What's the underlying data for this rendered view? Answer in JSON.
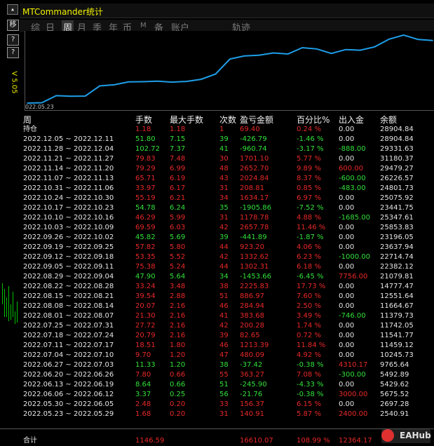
{
  "app": {
    "title": "MTCommander统计",
    "version": "V 5.05",
    "watermark": "EAHub"
  },
  "side_buttons": [
    "移",
    "?",
    "?"
  ],
  "tabs": [
    {
      "label": "综",
      "active": false
    },
    {
      "label": "日",
      "active": false
    },
    {
      "label": "周",
      "active": true
    },
    {
      "label": "月",
      "active": false
    },
    {
      "label": "季",
      "active": false
    },
    {
      "label": "年",
      "active": false
    },
    {
      "label": "币",
      "active": false
    },
    {
      "label": "M",
      "active": false
    },
    {
      "label": "备",
      "active": false
    },
    {
      "label": "账户",
      "active": false
    },
    {
      "label": "轨迹",
      "active": false
    }
  ],
  "colors": {
    "green": "#33e03a",
    "red": "#e82828",
    "white": "#e6e6e6",
    "line": "#1e9ee8",
    "title": "#f2f200"
  },
  "chart_data": {
    "type": "line",
    "x_label_start": "022.05.23",
    "series": [
      {
        "name": "",
        "values": [
          2540.91,
          2697.28,
          5675.52,
          5429.62,
          5492.89,
          9765.64,
          10245.73,
          11459.12,
          11541.77,
          11742.05,
          11379.73,
          11664.67,
          12551.64,
          14777.47,
          21079.81,
          22382.12,
          22714.74,
          23637.94,
          23196.05,
          25853.83,
          25347.61,
          23441.75,
          25075.92,
          24801.73,
          26226.57,
          29479.27,
          31180.37,
          29331.63,
          28904.84
        ]
      }
    ]
  },
  "table": {
    "headers": [
      "周",
      "手数",
      "最大手数",
      "次数",
      "盈亏金额",
      "百分比%",
      "出入金",
      "余额"
    ],
    "rows": [
      {
        "period": "持仓",
        "lots": "1.18",
        "max": "1.18",
        "n": "1",
        "pl": "69.40",
        "pct": "0.24 %",
        "io": "0.00",
        "bal": "28904.84",
        "c": "red",
        "io_c": "white"
      },
      {
        "period": "2022.12.05 ~ 2022.12.11",
        "lots": "51.80",
        "max": "7.15",
        "n": "39",
        "pl": "-426.79",
        "pct": "-1.46 %",
        "io": "0.00",
        "bal": "28904.84",
        "c": "green",
        "io_c": "white"
      },
      {
        "period": "2022.11.28 ~ 2022.12.04",
        "lots": "102.72",
        "max": "7.37",
        "n": "41",
        "pl": "-960.74",
        "pct": "-3.17 %",
        "io": "-888.00",
        "bal": "29331.63",
        "c": "green",
        "io_c": "green"
      },
      {
        "period": "2022.11.21 ~ 2022.11.27",
        "lots": "79.83",
        "max": "7.48",
        "n": "30",
        "pl": "1701.10",
        "pct": "5.77 %",
        "io": "0.00",
        "bal": "31180.37",
        "c": "red",
        "io_c": "white"
      },
      {
        "period": "2022.11.14 ~ 2022.11.20",
        "lots": "79.29",
        "max": "6.99",
        "n": "48",
        "pl": "2652.70",
        "pct": "9.89 %",
        "io": "600.00",
        "bal": "29479.27",
        "c": "red",
        "io_c": "red"
      },
      {
        "period": "2022.11.07 ~ 2022.11.13",
        "lots": "65.71",
        "max": "6.19",
        "n": "43",
        "pl": "2024.84",
        "pct": "8.37 %",
        "io": "-600.00",
        "bal": "26226.57",
        "c": "red",
        "io_c": "green"
      },
      {
        "period": "2022.10.31 ~ 2022.11.06",
        "lots": "33.97",
        "max": "6.17",
        "n": "31",
        "pl": "208.81",
        "pct": "0.85 %",
        "io": "-483.00",
        "bal": "24801.73",
        "c": "red",
        "io_c": "green"
      },
      {
        "period": "2022.10.24 ~ 2022.10.30",
        "lots": "55.19",
        "max": "6.21",
        "n": "34",
        "pl": "1634.17",
        "pct": "6.97 %",
        "io": "0.00",
        "bal": "25075.92",
        "c": "red",
        "io_c": "white"
      },
      {
        "period": "2022.10.17 ~ 2022.10.23",
        "lots": "54.78",
        "max": "6.24",
        "n": "35",
        "pl": "-1905.86",
        "pct": "-7.52 %",
        "io": "0.00",
        "bal": "23441.75",
        "c": "green",
        "io_c": "white"
      },
      {
        "period": "2022.10.10 ~ 2022.10.16",
        "lots": "46.29",
        "max": "5.99",
        "n": "31",
        "pl": "1178.78",
        "pct": "4.88 %",
        "io": "-1685.00",
        "bal": "25347.61",
        "c": "red",
        "io_c": "green"
      },
      {
        "period": "2022.10.03 ~ 2022.10.09",
        "lots": "69.59",
        "max": "6.03",
        "n": "42",
        "pl": "2657.78",
        "pct": "11.46 %",
        "io": "0.00",
        "bal": "25853.83",
        "c": "red",
        "io_c": "white"
      },
      {
        "period": "2022.09.26 ~ 2022.10.02",
        "lots": "45.82",
        "max": "5.69",
        "n": "39",
        "pl": "-441.89",
        "pct": "-1.87 %",
        "io": "0.00",
        "bal": "23196.05",
        "c": "green",
        "io_c": "white"
      },
      {
        "period": "2022.09.19 ~ 2022.09.25",
        "lots": "57.82",
        "max": "5.80",
        "n": "44",
        "pl": "923.20",
        "pct": "4.06 %",
        "io": "0.00",
        "bal": "23637.94",
        "c": "red",
        "io_c": "white"
      },
      {
        "period": "2022.09.12 ~ 2022.09.18",
        "lots": "53.35",
        "max": "5.52",
        "n": "42",
        "pl": "1332.62",
        "pct": "6.23 %",
        "io": "-1000.00",
        "bal": "22714.74",
        "c": "red",
        "io_c": "green"
      },
      {
        "period": "2022.09.05 ~ 2022.09.11",
        "lots": "75.38",
        "max": "5.24",
        "n": "44",
        "pl": "1302.31",
        "pct": "6.18 %",
        "io": "0.00",
        "bal": "22382.12",
        "c": "red",
        "io_c": "white"
      },
      {
        "period": "2022.08.29 ~ 2022.09.04",
        "lots": "47.90",
        "max": "5.64",
        "n": "34",
        "pl": "-1453.66",
        "pct": "-6.45 %",
        "io": "7756.00",
        "bal": "21079.81",
        "c": "green",
        "io_c": "red"
      },
      {
        "period": "2022.08.22 ~ 2022.08.28",
        "lots": "33.24",
        "max": "3.48",
        "n": "38",
        "pl": "2225.83",
        "pct": "17.73 %",
        "io": "0.00",
        "bal": "14777.47",
        "c": "red",
        "io_c": "white"
      },
      {
        "period": "2022.08.15 ~ 2022.08.21",
        "lots": "39.54",
        "max": "2.88",
        "n": "51",
        "pl": "886.97",
        "pct": "7.60 %",
        "io": "0.00",
        "bal": "12551.64",
        "c": "red",
        "io_c": "white"
      },
      {
        "period": "2022.08.08 ~ 2022.08.14",
        "lots": "20.07",
        "max": "2.16",
        "n": "46",
        "pl": "284.94",
        "pct": "2.50 %",
        "io": "0.00",
        "bal": "11664.67",
        "c": "red",
        "io_c": "white"
      },
      {
        "period": "2022.08.01 ~ 2022.08.07",
        "lots": "21.30",
        "max": "2.16",
        "n": "41",
        "pl": "383.68",
        "pct": "3.49 %",
        "io": "-746.00",
        "bal": "11379.73",
        "c": "red",
        "io_c": "green"
      },
      {
        "period": "2022.07.25 ~ 2022.07.31",
        "lots": "27.72",
        "max": "2.16",
        "n": "42",
        "pl": "200.28",
        "pct": "1.74 %",
        "io": "0.00",
        "bal": "11742.05",
        "c": "red",
        "io_c": "white"
      },
      {
        "period": "2022.07.18 ~ 2022.07.24",
        "lots": "20.79",
        "max": "2.16",
        "n": "39",
        "pl": "82.65",
        "pct": "0.72 %",
        "io": "0.00",
        "bal": "11541.77",
        "c": "red",
        "io_c": "white"
      },
      {
        "period": "2022.07.11 ~ 2022.07.17",
        "lots": "18.51",
        "max": "1.80",
        "n": "46",
        "pl": "1213.39",
        "pct": "11.84 %",
        "io": "0.00",
        "bal": "11459.12",
        "c": "red",
        "io_c": "white"
      },
      {
        "period": "2022.07.04 ~ 2022.07.10",
        "lots": "9.70",
        "max": "1.20",
        "n": "47",
        "pl": "480.09",
        "pct": "4.92 %",
        "io": "0.00",
        "bal": "10245.73",
        "c": "red",
        "io_c": "white"
      },
      {
        "period": "2022.06.27 ~ 2022.07.03",
        "lots": "11.33",
        "max": "1.20",
        "n": "38",
        "pl": "-37.42",
        "pct": "-0.38 %",
        "io": "4310.17",
        "bal": "9765.64",
        "c": "green",
        "io_c": "red"
      },
      {
        "period": "2022.06.20 ~ 2022.06.26",
        "lots": "7.80",
        "max": "0.66",
        "n": "55",
        "pl": "363.27",
        "pct": "7.08 %",
        "io": "-300.00",
        "bal": "5492.89",
        "c": "red",
        "io_c": "green"
      },
      {
        "period": "2022.06.13 ~ 2022.06.19",
        "lots": "8.64",
        "max": "0.66",
        "n": "51",
        "pl": "-245.90",
        "pct": "-4.33 %",
        "io": "0.00",
        "bal": "5429.62",
        "c": "green",
        "io_c": "white"
      },
      {
        "period": "2022.06.06 ~ 2022.06.12",
        "lots": "3.37",
        "max": "0.25",
        "n": "56",
        "pl": "-21.76",
        "pct": "-0.38 %",
        "io": "3000.00",
        "bal": "5675.52",
        "c": "green",
        "io_c": "red"
      },
      {
        "period": "2022.05.30 ~ 2022.06.05",
        "lots": "2.48",
        "max": "0.20",
        "n": "33",
        "pl": "156.37",
        "pct": "6.15 %",
        "io": "0.00",
        "bal": "2697.28",
        "c": "red",
        "io_c": "white"
      },
      {
        "period": "2022.05.23 ~ 2022.05.29",
        "lots": "1.68",
        "max": "0.20",
        "n": "31",
        "pl": "140.91",
        "pct": "5.87 %",
        "io": "2400.00",
        "bal": "2540.91",
        "c": "red",
        "io_c": "red"
      }
    ],
    "total": {
      "period": "合计",
      "lots": "1146.59",
      "pl": "16610.07",
      "pct": "108.99 %",
      "io": "12364.17"
    }
  }
}
